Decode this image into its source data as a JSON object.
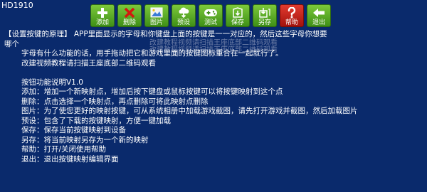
{
  "status_label": "HD1910",
  "toolbar": {
    "buttons": [
      {
        "label": "添加",
        "icon": "plus-icon"
      },
      {
        "label": "删除",
        "icon": "close-icon"
      },
      {
        "label": "图片",
        "icon": "image-icon"
      },
      {
        "label": "预设",
        "icon": "download-cloud-icon"
      },
      {
        "label": "测试",
        "icon": "gamepad-icon"
      },
      {
        "label": "保存",
        "icon": "save-icon"
      },
      {
        "label": "另存",
        "icon": "save-as-icon"
      },
      {
        "label": "帮助",
        "icon": "help-icon"
      },
      {
        "label": "退出",
        "icon": "back-arrow-icon"
      }
    ]
  },
  "overlay_text": {
    "line1": "改建教程视频请扫描王座底部二维码观看",
    "line2": "改建教程视频请扫描王座底部二维码观看"
  },
  "help": {
    "principle_line1": "【设置按键的原理】 APP里面显示的字母和你键盘上面的按键是一一对应的，然后这些字母你想要",
    "principle_line2": "哪个",
    "principle_line3": "字母有什么功能的话，用手拖动把它和游戏里面的按键图标重合在一起就行了。",
    "video_line": "改建视频教程请扫描王座底部二维码观看",
    "section_title": "按钮功能说明V1.0",
    "items": [
      "添加：增加一个新映射点，增加后按下键盘或鼠标按键可以将按键映射到这个点",
      "删除：点击选择一个映射点，再点删除可将此映射点删除",
      "图片：为了使您更好的映射按键，可从系统相册中加载游戏截图，请先打开游戏并截图，然后加载图片",
      "预设：包含了下载的按键映射，方便一键加载",
      "保存：保存当前按键映射到设备",
      "另存：将当前映射另存为一个新的映射",
      "帮助：打开/关闭使用帮助",
      "退出：退出按键映射编辑界面"
    ]
  }
}
